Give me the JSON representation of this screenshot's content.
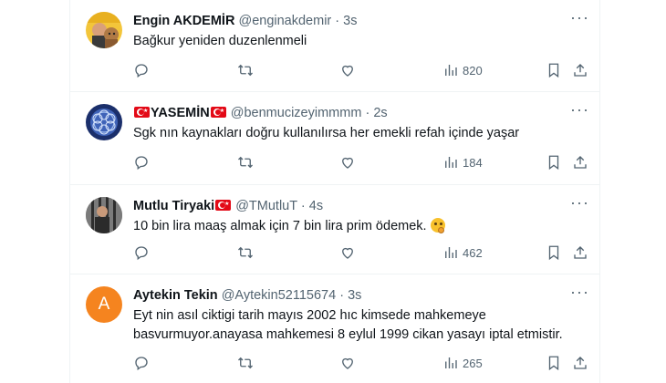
{
  "tweets": [
    {
      "name": "Engin AKDEMİR",
      "handle": "@enginakdemir",
      "separator": "·",
      "time": "3s",
      "text": "Bağkur yeniden duzenlenmeli",
      "views": "820",
      "name_flags": "none"
    },
    {
      "name": "YASEMİN",
      "handle": "@benmucizeyimmmm",
      "separator": "·",
      "time": "2s",
      "text": "Sgk nın kaynakları doğru kullanılırsa her emekli refah içinde yaşar",
      "views": "184",
      "name_flags": "both"
    },
    {
      "name": "Mutlu Tiryaki",
      "handle": "@TMutluT",
      "separator": "·",
      "time": "4s",
      "text": "10 bin lira maaş almak için 7 bin lira prim ödemek.",
      "views": "462",
      "name_flags": "after",
      "emoji": "thinking-face"
    },
    {
      "name": "Aytekin Tekin",
      "handle": "@Aytekin52115674",
      "separator": "·",
      "time": "3s",
      "text": "Eyt nin asıl ciktigi tarih mayıs 2002 hıc kimsede mahkemeye basvurmuyor.anayasa mahkemesi 8 eylul 1999 cikan yasayı iptal etmistir.",
      "views": "265",
      "avatar_letter": "A",
      "name_flags": "none"
    }
  ],
  "colors": {
    "text": "#0f1419",
    "secondary": "#536471",
    "divider": "#eff3f4",
    "avatar_orange": "#f5841f",
    "flag_red": "#e30a17"
  },
  "icons": [
    "reply-icon",
    "retweet-icon",
    "like-icon",
    "views-icon",
    "bookmark-icon",
    "share-icon",
    "more-icon"
  ]
}
